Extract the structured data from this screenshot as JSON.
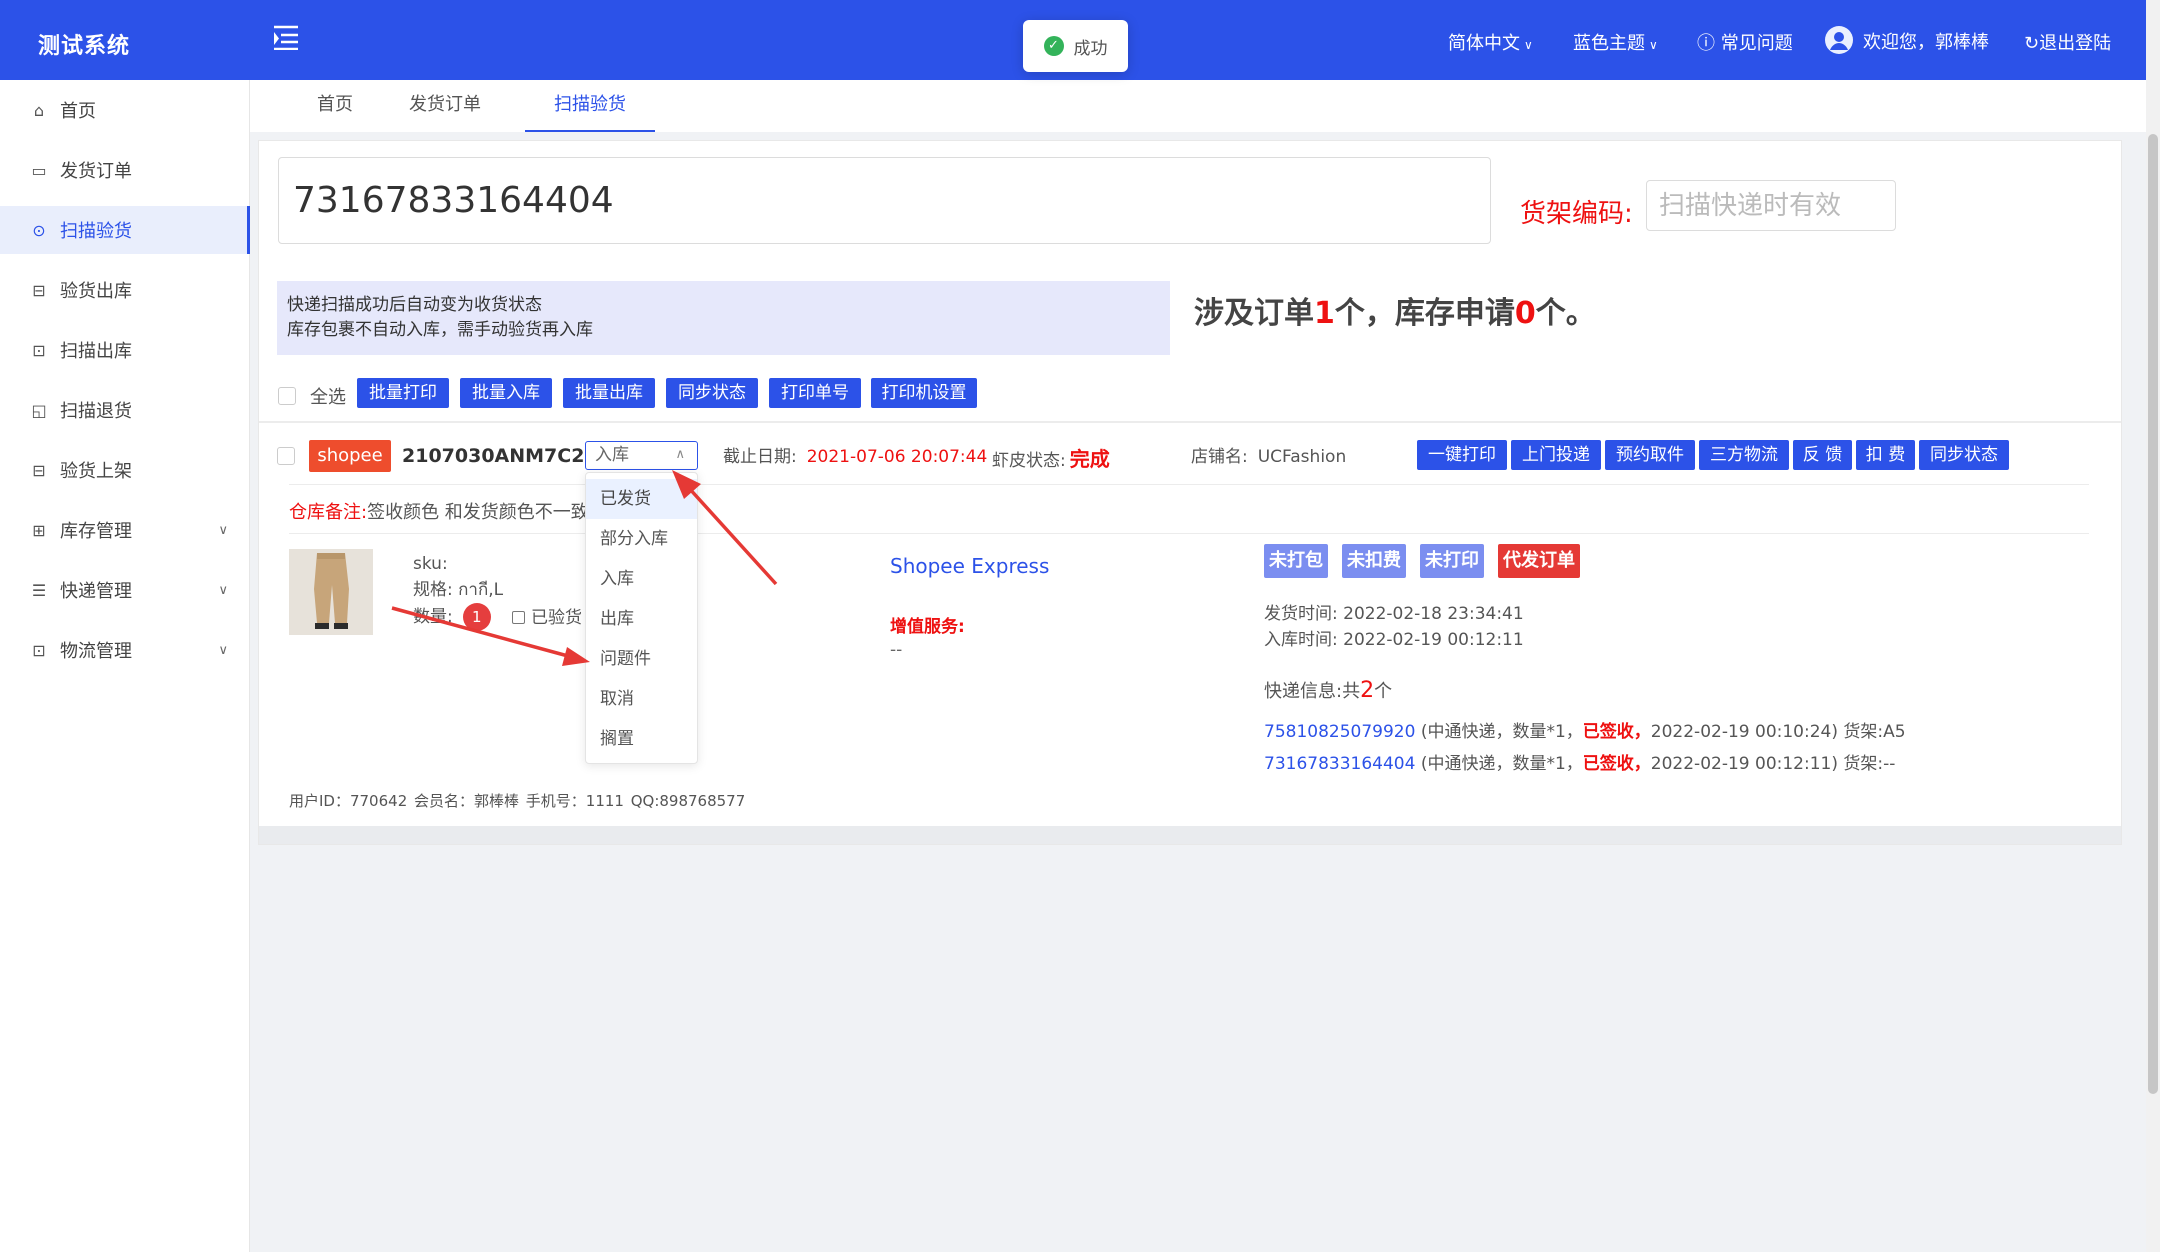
{
  "header": {
    "logo": "测试系统",
    "toast": "成功",
    "language": "简体中文",
    "theme": "蓝色主题",
    "faq": "常见问题",
    "welcome": "欢迎您，郭棒棒",
    "logout": "退出登陆"
  },
  "sidebar": {
    "items": [
      {
        "label": "首页",
        "icon": "home-icon"
      },
      {
        "label": "发货订单",
        "icon": "bag-icon"
      },
      {
        "label": "扫描验货",
        "icon": "scan-shield-icon"
      },
      {
        "label": "验货出库",
        "icon": "scan-frame-icon"
      },
      {
        "label": "扫描出库",
        "icon": "truck-icon"
      },
      {
        "label": "扫描退货",
        "icon": "return-icon"
      },
      {
        "label": "验货上架",
        "icon": "scan-frame-icon"
      },
      {
        "label": "库存管理",
        "icon": "grid-icon"
      },
      {
        "label": "快递管理",
        "icon": "list-icon"
      },
      {
        "label": "物流管理",
        "icon": "truck-icon"
      }
    ]
  },
  "tabs": [
    "首页",
    "发货订单",
    "扫描验货"
  ],
  "scan": {
    "tracking_value": "73167833164404",
    "shelf_label": "货架编码:",
    "shelf_placeholder": "扫描快递时有效"
  },
  "notice": {
    "line1": "快递扫描成功后自动变为收货状态",
    "line2": "库存包裹不自动入库，需手动验货再入库"
  },
  "summary": {
    "prefix": "涉及订单",
    "orders": "1",
    "middle": "个，库存申请",
    "requests": "0",
    "suffix": "个。"
  },
  "batch": {
    "select_all": "全选",
    "buttons": [
      "批量打印",
      "批量入库",
      "批量出库",
      "同步状态",
      "打印单号",
      "打印机设置"
    ]
  },
  "order": {
    "platform": "shopee",
    "order_no": "2107030ANM7C27",
    "status_value": "入库",
    "deadline_label": "截止日期:",
    "deadline_value": "2021-07-06 20:07:44",
    "shopee_status_label": "虾皮状态:",
    "shopee_status_value": "完成",
    "shop_label": "店铺名:",
    "shop_value": "UCFashion",
    "actions": [
      "一键打印",
      "上门投递",
      "预约取件",
      "三方物流",
      "反 馈",
      "扣 费",
      "同步状态"
    ],
    "remark_label": "仓库备注:",
    "remark_value": "签收颜色 和发货颜色不一致",
    "sku_label": "sku:",
    "spec_label": "规格:",
    "spec_value": "กากี,L",
    "qty_label": "数量:",
    "qty_value": "1",
    "checked_label": "已验货",
    "carrier": "Shopee Express",
    "vas_label": "增值服务:",
    "vas_value": "--",
    "tags": [
      {
        "label": "未打包",
        "color": "#7b8ef0"
      },
      {
        "label": "未扣费",
        "color": "#7b8ef0"
      },
      {
        "label": "未打印",
        "color": "#7b8ef0"
      },
      {
        "label": "代发订单",
        "color": "#e53935"
      }
    ],
    "ship_time_label": "发货时间:",
    "ship_time": "2022-02-18 23:34:41",
    "in_time_label": "入库时间:",
    "in_time": "2022-02-19 00:12:11",
    "express_label": "快递信息:",
    "express_total_prefix": "共",
    "express_count": "2",
    "express_total_suffix": "个",
    "express": [
      {
        "tracking": "75810825079920",
        "detail": "(中通快递，数量*1，",
        "signed": "已签收，",
        "time_shelf": "2022-02-19 00:10:24) 货架:A5"
      },
      {
        "tracking": "73167833164404",
        "detail": "(中通快递，数量*1，",
        "signed": "已签收，",
        "time_shelf": "2022-02-19 00:12:11) 货架:--"
      }
    ],
    "user_line": "用户ID：770642   会员名：郭棒棒   手机号：1111   QQ:898768577"
  },
  "status_options": [
    "已发货",
    "部分入库",
    "入库",
    "出库",
    "问题件",
    "取消",
    "搁置"
  ],
  "colors": {
    "primary": "#2c52e8",
    "danger": "#e11111",
    "shopee": "#ee4d2d",
    "tag_blue": "#7b8ef0"
  }
}
